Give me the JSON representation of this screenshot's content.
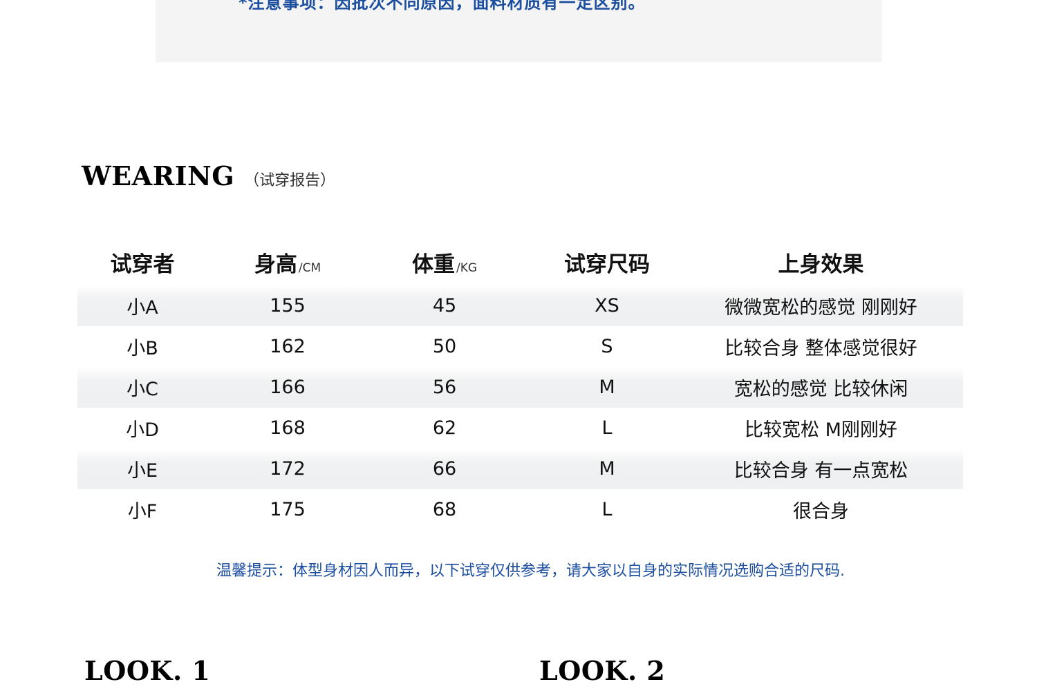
{
  "notice": {
    "text": "*注意事项：因批次不同原因，面料材质有一定区别。"
  },
  "section": {
    "title": "WEARING",
    "subtitle": "（试穿报告）"
  },
  "table": {
    "headers": {
      "name": "试穿者",
      "height": "身高",
      "height_unit": "/CM",
      "weight": "体重",
      "weight_unit": "/KG",
      "size": "试穿尺码",
      "effect": "上身效果"
    },
    "rows": [
      {
        "name": "小A",
        "height": "155",
        "weight": "45",
        "size": "XS",
        "effect": "微微宽松的感觉 刚刚好"
      },
      {
        "name": "小B",
        "height": "162",
        "weight": "50",
        "size": "S",
        "effect": "比较合身 整体感觉很好"
      },
      {
        "name": "小C",
        "height": "166",
        "weight": "56",
        "size": "M",
        "effect": "宽松的感觉 比较休闲"
      },
      {
        "name": "小D",
        "height": "168",
        "weight": "62",
        "size": "L",
        "effect": "比较宽松 M刚刚好"
      },
      {
        "name": "小E",
        "height": "172",
        "weight": "66",
        "size": "M",
        "effect": "比较合身 有一点宽松"
      },
      {
        "name": "小F",
        "height": "175",
        "weight": "68",
        "size": "L",
        "effect": "很合身"
      }
    ]
  },
  "tip": {
    "text": "温馨提示：体型身材因人而异，以下试穿仅供参考，请大家以自身的实际情况选购合适的尺码."
  },
  "looks": {
    "look1": "LOOK. 1",
    "look2": "LOOK. 2"
  }
}
